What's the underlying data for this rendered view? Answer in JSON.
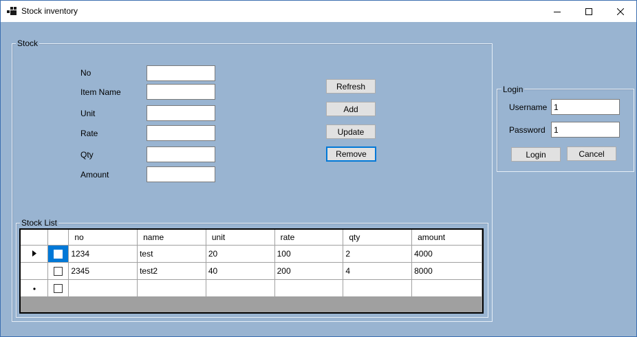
{
  "window": {
    "title": "Stock inventory",
    "icons": {
      "app": "app-icon",
      "minimize": "minimize-icon",
      "maximize": "maximize-icon",
      "close": "close-icon"
    }
  },
  "stock": {
    "legend": "Stock",
    "fields": {
      "no": {
        "label": "No",
        "value": ""
      },
      "item_name": {
        "label": "Item Name",
        "value": ""
      },
      "unit": {
        "label": "Unit",
        "value": ""
      },
      "rate": {
        "label": "Rate",
        "value": ""
      },
      "qty": {
        "label": "Qty",
        "value": ""
      },
      "amount": {
        "label": "Amount",
        "value": ""
      }
    },
    "buttons": {
      "refresh": "Refresh",
      "add": "Add",
      "update": "Update",
      "remove": "Remove"
    }
  },
  "login": {
    "legend": "Login",
    "username_label": "Username",
    "username_value": "1",
    "password_label": "Password",
    "password_value": "1",
    "login_button": "Login",
    "cancel_button": "Cancel"
  },
  "stock_list": {
    "legend": "Stock List",
    "columns": [
      "no",
      "name",
      "unit",
      "rate",
      "qty",
      "amount"
    ],
    "rows": [
      {
        "checked": false,
        "no": "1234",
        "name": "test",
        "unit": "20",
        "rate": "100",
        "qty": "2",
        "amount": "4000"
      },
      {
        "checked": false,
        "no": "2345",
        "name": "test2",
        "unit": "40",
        "rate": "200",
        "qty": "4",
        "amount": "8000"
      },
      {
        "checked": false,
        "no": "",
        "name": "",
        "unit": "",
        "rate": "",
        "qty": "",
        "amount": ""
      }
    ],
    "row_indicators": [
      "current-row-arrow-icon",
      "",
      "new-row-asterisk-icon"
    ],
    "colors": {
      "selection": "#0078d7",
      "grid_background": "#a0a0a0"
    }
  }
}
